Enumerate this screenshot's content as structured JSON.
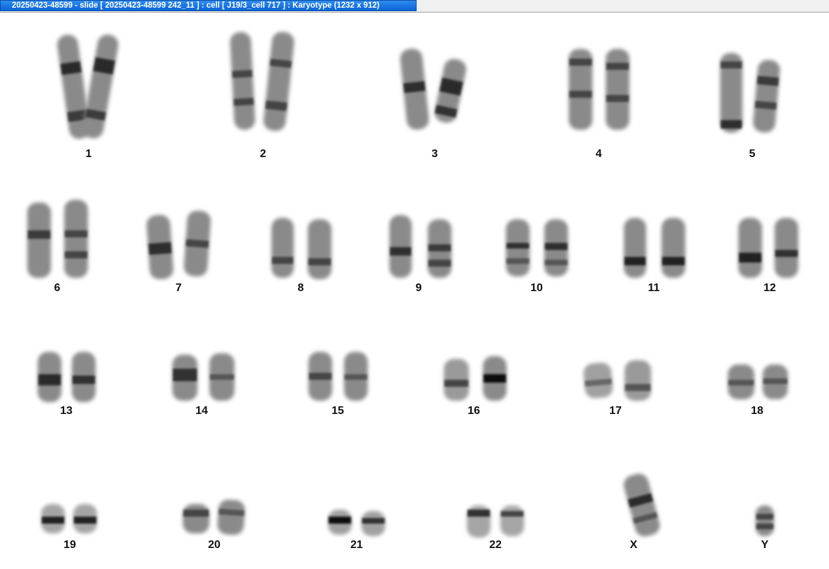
{
  "window": {
    "title": "20250423-48599 - slide [ 20250423-48599 242_11 ] : cell [ J19/3_cell 717 ] : Karyotype  (1232 x 912)"
  },
  "karyotype": {
    "pairs": [
      {
        "label": "1"
      },
      {
        "label": "2"
      },
      {
        "label": "3"
      },
      {
        "label": "4"
      },
      {
        "label": "5"
      },
      {
        "label": "6"
      },
      {
        "label": "7"
      },
      {
        "label": "8"
      },
      {
        "label": "9"
      },
      {
        "label": "10"
      },
      {
        "label": "11"
      },
      {
        "label": "12"
      },
      {
        "label": "13"
      },
      {
        "label": "14"
      },
      {
        "label": "15"
      },
      {
        "label": "16"
      },
      {
        "label": "17"
      },
      {
        "label": "18"
      },
      {
        "label": "19"
      },
      {
        "label": "20"
      },
      {
        "label": "21"
      },
      {
        "label": "22"
      },
      {
        "label": "X"
      },
      {
        "label": "Y"
      }
    ]
  }
}
